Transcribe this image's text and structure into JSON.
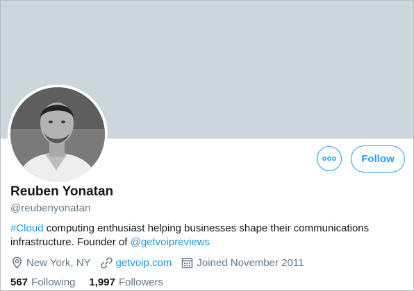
{
  "colors": {
    "accent": "#1da1f2",
    "link": "#1b95e0",
    "banner": "#ccd6dd",
    "secondary_text": "#657786"
  },
  "profile": {
    "display_name": "Reuben Yonatan",
    "handle": "@reubenyonatan",
    "avatar_icon": "profile-photo"
  },
  "actions": {
    "more_icon": "more-dots-icon",
    "follow_label": "Follow"
  },
  "bio": {
    "hashtag": "#Cloud",
    "text_1": " computing enthusiast helping businesses shape their communications infrastructure. Founder of ",
    "mention": "@getvoipreviews"
  },
  "meta": {
    "location": "New York, NY",
    "location_icon": "location-pin-icon",
    "website": "getvoip.com",
    "website_icon": "link-icon",
    "joined": "Joined November 2011",
    "joined_icon": "calendar-icon"
  },
  "stats": {
    "following_count": "567",
    "following_label": "Following",
    "followers_count": "1,997",
    "followers_label": "Followers"
  }
}
